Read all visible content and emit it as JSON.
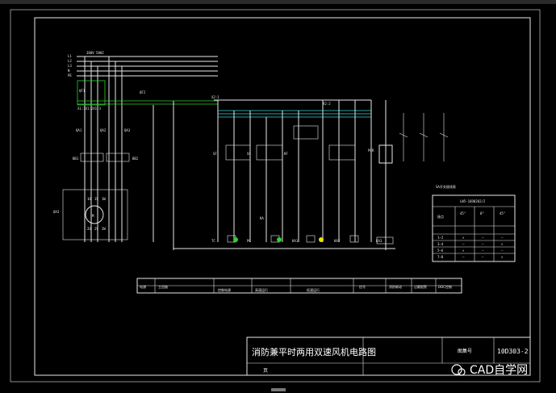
{
  "drawing": {
    "title": "消防兼平时两用双速风机电路图",
    "drawing_no_label": "图集号",
    "drawing_no": "10D303-2",
    "page_label": "页",
    "watermark": "CAD自学网"
  },
  "power_bus": {
    "spec": "380V 50HZ",
    "lines": [
      "L1",
      "L2",
      "L3",
      "N",
      "PE"
    ]
  },
  "circuit_labels": {
    "qf1": "QF1",
    "qf2": "QF2",
    "qa1": "QA1",
    "qa2": "QA2",
    "qa3": "QA3",
    "bb1": "BB1",
    "bb2": "BB2",
    "ma": "M",
    "terminals": "X1:1X1:2X1:3",
    "motor_terms": [
      "1U",
      "1V",
      "1W",
      "2U",
      "2V",
      "2W"
    ],
    "control_tags": [
      "SF",
      "SS",
      "KA",
      "KF",
      "TC",
      "PG",
      "PGR",
      "KA1",
      "KA2",
      "KA3",
      "X2:1",
      "X2:2"
    ]
  },
  "switch_table": {
    "title": "SA开关接线表",
    "model": "LW5-16D0202/2",
    "col_header_left": "接点",
    "positions": [
      "45°",
      "0°",
      "45°"
    ],
    "rows": [
      {
        "contact": "1—2",
        "marks": [
          "×",
          "—",
          "—"
        ]
      },
      {
        "contact": "3—4",
        "marks": [
          "—",
          "—",
          "×"
        ]
      },
      {
        "contact": "5—6",
        "marks": [
          "×",
          "—",
          "—"
        ]
      },
      {
        "contact": "7—8",
        "marks": [
          "—",
          "—",
          "×"
        ]
      }
    ]
  },
  "function_row": {
    "cells": [
      "电源",
      "主回路",
      "控制电源",
      "高速运行",
      "低速运行",
      "信号",
      "消防联动",
      "过载报警",
      "DDC控制"
    ]
  },
  "colors": {
    "background": "#000000",
    "lines": "#e8e8e8",
    "cyan": "#33d6d6",
    "green": "#2fd02f",
    "yellow": "#e6e600"
  }
}
